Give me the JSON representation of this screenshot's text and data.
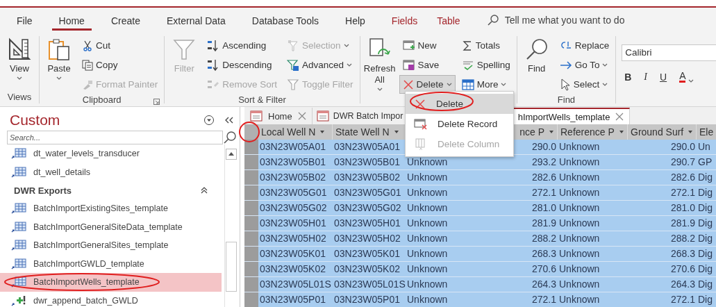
{
  "ribbon": {
    "tabs": [
      {
        "label": "File",
        "selected": false,
        "contextual": false
      },
      {
        "label": "Home",
        "selected": true,
        "contextual": false
      },
      {
        "label": "Create",
        "selected": false,
        "contextual": false
      },
      {
        "label": "External Data",
        "selected": false,
        "contextual": false
      },
      {
        "label": "Database Tools",
        "selected": false,
        "contextual": false
      },
      {
        "label": "Help",
        "selected": false,
        "contextual": false
      },
      {
        "label": "Fields",
        "selected": false,
        "contextual": true
      },
      {
        "label": "Table",
        "selected": false,
        "contextual": true
      }
    ],
    "tell_me": {
      "placeholder": "Tell me what you want to do"
    },
    "groups": [
      {
        "label": "Views",
        "columns": [
          {
            "kind": "large",
            "items": [
              {
                "label": "View",
                "caret": true,
                "disabled": false
              }
            ]
          }
        ]
      },
      {
        "label": "Clipboard",
        "launcher": true,
        "columns": [
          {
            "kind": "large",
            "items": [
              {
                "label": "Paste",
                "caret": true,
                "disabled": false
              }
            ]
          },
          {
            "kind": "stack",
            "items": [
              {
                "label": "Cut",
                "disabled": false
              },
              {
                "label": "Copy",
                "disabled": false
              },
              {
                "label": "Format Painter",
                "disabled": true
              }
            ]
          }
        ]
      },
      {
        "label": "Sort & Filter",
        "columns": [
          {
            "kind": "large",
            "items": [
              {
                "label": "Filter",
                "disabled": true
              }
            ]
          },
          {
            "kind": "stack",
            "items": [
              {
                "label": "Ascending",
                "disabled": false
              },
              {
                "label": "Descending",
                "disabled": false
              },
              {
                "label": "Remove Sort",
                "disabled": true
              }
            ]
          },
          {
            "kind": "stack",
            "items": [
              {
                "label": "Selection",
                "caret": true,
                "disabled": true
              },
              {
                "label": "Advanced",
                "caret": true,
                "disabled": false
              },
              {
                "label": "Toggle Filter",
                "disabled": true
              }
            ]
          }
        ]
      },
      {
        "columns": [
          {
            "kind": "large",
            "items": [
              {
                "label": "Refresh All",
                "caret": true,
                "disabled": false
              }
            ]
          },
          {
            "kind": "stack",
            "items": [
              {
                "label": "New",
                "disabled": false,
                "pressed": false
              },
              {
                "label": "Save",
                "disabled": false,
                "pressed": false
              },
              {
                "label": "Delete",
                "caret": true,
                "disabled": false,
                "pressed": true
              }
            ]
          },
          {
            "kind": "stack",
            "items": [
              {
                "label": "Totals",
                "disabled": false
              },
              {
                "label": "Spelling",
                "disabled": false
              },
              {
                "label": "More",
                "caret": true,
                "disabled": false
              }
            ]
          }
        ]
      },
      {
        "label": "Find",
        "columns": [
          {
            "kind": "large",
            "items": [
              {
                "label": "Find",
                "disabled": false
              }
            ]
          },
          {
            "kind": "stack",
            "items": [
              {
                "label": "Replace",
                "disabled": false
              },
              {
                "label": "Go To",
                "caret": true,
                "disabled": false
              },
              {
                "label": "Select",
                "caret": true,
                "disabled": false
              }
            ]
          }
        ]
      },
      {
        "columns": [
          {
            "kind": "format",
            "font": {
              "value": "Calibri"
            },
            "buttons": [
              {
                "label": "B",
                "kind": "bold"
              },
              {
                "label": "I",
                "kind": "italic"
              },
              {
                "label": "U",
                "kind": "underline"
              },
              {
                "label": "A",
                "kind": "color",
                "caret": true
              }
            ]
          }
        ]
      }
    ]
  },
  "delete_menu": {
    "items": [
      {
        "label": "Delete",
        "selected": true,
        "disabled": false
      },
      {
        "label": "Delete Record",
        "selected": false,
        "disabled": false
      },
      {
        "label": "Delete Column",
        "selected": false,
        "disabled": true
      }
    ]
  },
  "navigation": {
    "title": "Custom",
    "search": {
      "placeholder": "Search..."
    },
    "items": [
      {
        "kind": "table",
        "label": "dt_water_levels_transducer",
        "selected": false
      },
      {
        "kind": "table",
        "label": "dt_well_details",
        "selected": false
      },
      {
        "kind": "group",
        "label": "DWR Exports",
        "expanded": true
      },
      {
        "kind": "table",
        "label": "BatchImportExistingSites_template",
        "selected": false
      },
      {
        "kind": "table",
        "label": "BatchImportGeneralSiteData_template",
        "selected": false
      },
      {
        "kind": "table",
        "label": "BatchImportGeneralSites_template",
        "selected": false
      },
      {
        "kind": "table",
        "label": "BatchImportGWLD_template",
        "selected": false
      },
      {
        "kind": "table",
        "label": "BatchImportWells_template",
        "selected": true
      },
      {
        "kind": "query",
        "label": "dwr_append_batch_GWLD",
        "selected": false
      }
    ]
  },
  "documents": {
    "tabs": [
      {
        "label": "Home",
        "selected": false,
        "closable": true
      },
      {
        "label": "DWR Batch Impor",
        "selected": false,
        "closable": false
      },
      {
        "label": "hImportWells_template",
        "selected": true,
        "closable": true
      }
    ]
  },
  "table": {
    "columns": [
      "Local Well N",
      "State Well N",
      null,
      "nce P",
      "Reference P",
      "Ground Surf",
      "Ele"
    ],
    "rows": [
      {
        "selected": true,
        "cells": [
          "03N23W05A01",
          "03N23W05A01",
          null,
          "290.0",
          "Unknown",
          "290.0",
          "Un"
        ]
      },
      {
        "selected": true,
        "cells": [
          "03N23W05B01",
          "03N23W05B01",
          "Unknown",
          "293.2",
          "Unknown",
          "290.7",
          "GP"
        ]
      },
      {
        "selected": true,
        "cells": [
          "03N23W05B02",
          "03N23W05B02",
          "Unknown",
          "282.6",
          "Unknown",
          "282.6",
          "Dig"
        ]
      },
      {
        "selected": true,
        "cells": [
          "03N23W05G01",
          "03N23W05G01",
          "Unknown",
          "272.1",
          "Unknown",
          "272.1",
          "Dig"
        ]
      },
      {
        "selected": true,
        "cells": [
          "03N23W05G02",
          "03N23W05G02",
          "Unknown",
          "281.0",
          "Unknown",
          "281.0",
          "Dig"
        ]
      },
      {
        "selected": true,
        "cells": [
          "03N23W05H01",
          "03N23W05H01",
          "Unknown",
          "281.9",
          "Unknown",
          "281.9",
          "Dig"
        ]
      },
      {
        "selected": true,
        "cells": [
          "03N23W05H02",
          "03N23W05H02",
          "Unknown",
          "288.2",
          "Unknown",
          "288.2",
          "Dig"
        ]
      },
      {
        "selected": true,
        "cells": [
          "03N23W05K01",
          "03N23W05K01",
          "Unknown",
          "268.3",
          "Unknown",
          "268.3",
          "Dig"
        ]
      },
      {
        "selected": true,
        "cells": [
          "03N23W05K02",
          "03N23W05K02",
          "Unknown",
          "270.6",
          "Unknown",
          "270.6",
          "Dig"
        ]
      },
      {
        "selected": true,
        "cells": [
          "03N23W05L01S",
          "03N23W05L01S",
          "Unknown",
          "264.3",
          "Unknown",
          "264.3",
          "Dig"
        ]
      },
      {
        "selected": true,
        "cells": [
          "03N23W05P01",
          "03N23W05P01",
          "Unknown",
          "272.1",
          "Unknown",
          "272.1",
          "Dig"
        ]
      }
    ]
  }
}
